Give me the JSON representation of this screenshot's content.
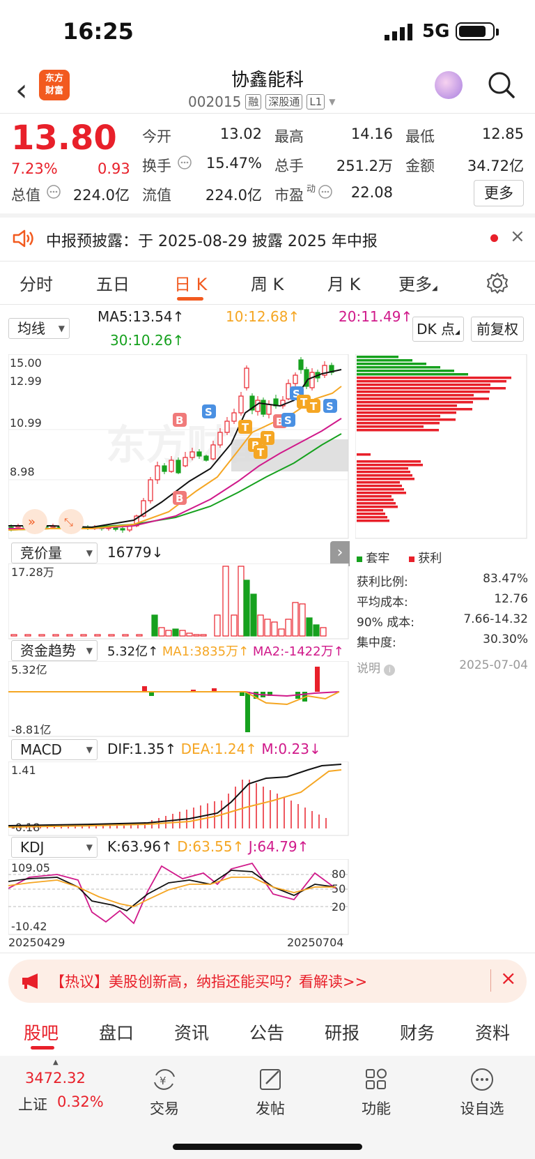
{
  "status": {
    "time": "16:25",
    "network": "5G"
  },
  "header": {
    "logo": "东方财富",
    "name": "协鑫能科",
    "code": "002015",
    "tags": [
      "融",
      "深股通",
      "L1"
    ]
  },
  "quote": {
    "price": "13.80",
    "pct": "7.23%",
    "change": "0.93",
    "rows": [
      [
        [
          "今开",
          "13.02",
          "red"
        ],
        [
          "最高",
          "14.16",
          "red"
        ],
        [
          "最低",
          "12.85",
          "green"
        ]
      ],
      [
        [
          "换手",
          "15.47%",
          ""
        ],
        [
          "总手",
          "251.2万",
          ""
        ],
        [
          "金额",
          "34.72亿",
          ""
        ]
      ],
      [
        [
          "总值",
          "224.0亿",
          ""
        ],
        [
          "流值",
          "224.0亿",
          ""
        ],
        [
          "市盈",
          "22.08",
          ""
        ]
      ]
    ],
    "pe_sup": "动",
    "more": "更多"
  },
  "notice": {
    "text": "中报预披露：于 2025-08-29 披露 2025 年中报"
  },
  "tabs": [
    "分时",
    "五日",
    "日 K",
    "周 K",
    "月 K",
    "更多"
  ],
  "active_tab": "日 K",
  "chart_controls": {
    "ma_select": "均线",
    "dk": "DK 点",
    "adjust": "前复权"
  },
  "ma": {
    "ma5": "MA5:13.54",
    "ma10": "10:12.68",
    "ma20": "20:11.49",
    "ma30": "30:10.26"
  },
  "kline_axis": [
    "15.00",
    "12.99",
    "10.99",
    "8.98"
  ],
  "watermark": "东方财富",
  "chips": {
    "legend_trapped": "套牢",
    "legend_profit": "获利",
    "stats": [
      [
        "获利比例:",
        "83.47%"
      ],
      [
        "平均成本:",
        "12.76"
      ],
      [
        "90% 成本:",
        "7.66-14.32"
      ],
      [
        "集中度:",
        "30.30%"
      ]
    ],
    "note": "说明",
    "date": "2025-07-04"
  },
  "auction": {
    "select": "竞价量",
    "value": "16779",
    "axis_max": "17.28万"
  },
  "fund": {
    "select": "资金趋势",
    "value": "5.32亿",
    "ma1": "MA1:3835万",
    "ma2": "MA2:-1422万",
    "axis_max": "5.32亿",
    "axis_min": "-8.81亿"
  },
  "macd": {
    "select": "MACD",
    "dif": "DIF:1.35",
    "dea": "DEA:1.24",
    "m": "M:0.23",
    "axis_max": "1.41",
    "axis_min": "-0.18"
  },
  "kdj": {
    "select": "KDJ",
    "k": "K:63.96",
    "d": "D:63.55",
    "j": "J:64.79",
    "axis_max": "109.05",
    "axis_min": "-10.42",
    "levels": [
      "80",
      "50",
      "20"
    ],
    "date_start": "20250429",
    "date_end": "20250704"
  },
  "arrows": {
    "up": "↑",
    "down": "↓"
  },
  "banner": {
    "text": "【热议】美股创新高，纳指还能买吗？看解读>>"
  },
  "bottom_tabs": [
    "股吧",
    "盘口",
    "资讯",
    "公告",
    "研报",
    "财务",
    "资料"
  ],
  "index": {
    "value": "3472.32",
    "name": "上证",
    "pct": "0.32%"
  },
  "nav": [
    "交易",
    "发帖",
    "功能",
    "设自选"
  ],
  "colors": {
    "up": "#e8202a",
    "down": "#16a11e",
    "accent": "#f25a1f"
  }
}
